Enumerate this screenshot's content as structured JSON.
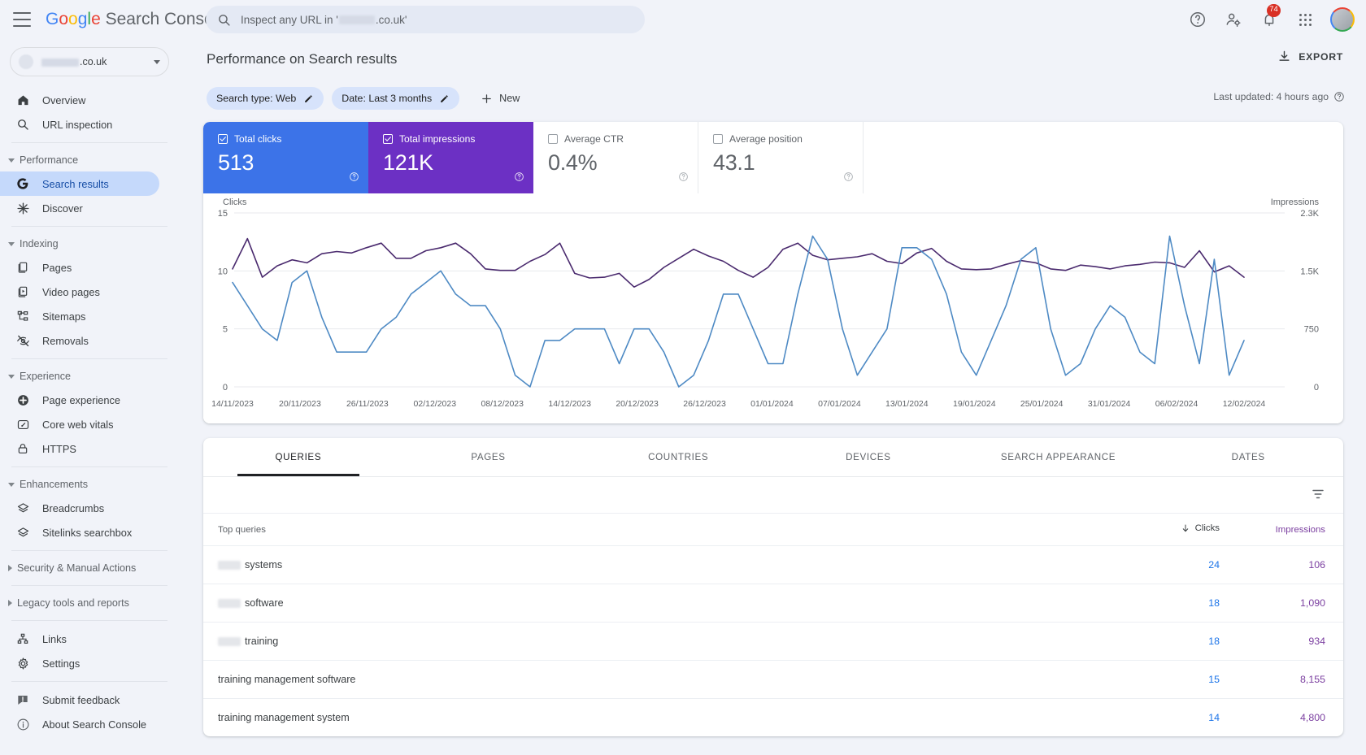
{
  "header": {
    "product_name_parts": [
      "G",
      "o",
      "o",
      "g",
      "l",
      "e"
    ],
    "product_suffix": " Search Console",
    "search_placeholder_pre": "Inspect any URL in '",
    "search_placeholder_post": ".co.uk'",
    "notification_count": "74",
    "icons": [
      "menu-icon",
      "search-icon",
      "help-icon",
      "user-settings-icon",
      "notifications-icon",
      "apps-grid-icon",
      "account-avatar"
    ]
  },
  "sidebar": {
    "property": {
      "name_suffix": ".co.uk"
    },
    "items": [
      {
        "label": "Overview",
        "icon": "home-icon",
        "type": "item"
      },
      {
        "label": "URL inspection",
        "icon": "search-icon",
        "type": "item"
      },
      {
        "label": "Performance",
        "icon": "chevron-down-icon",
        "type": "group",
        "expanded": true
      },
      {
        "label": "Search results",
        "icon": "google-g-icon",
        "type": "item",
        "active": true
      },
      {
        "label": "Discover",
        "icon": "discover-icon",
        "type": "item"
      },
      {
        "label": "Indexing",
        "icon": "chevron-down-icon",
        "type": "group",
        "expanded": true
      },
      {
        "label": "Pages",
        "icon": "pages-icon",
        "type": "item"
      },
      {
        "label": "Video pages",
        "icon": "video-pages-icon",
        "type": "item"
      },
      {
        "label": "Sitemaps",
        "icon": "sitemaps-icon",
        "type": "item"
      },
      {
        "label": "Removals",
        "icon": "removals-icon",
        "type": "item"
      },
      {
        "label": "Experience",
        "icon": "chevron-down-icon",
        "type": "group",
        "expanded": true
      },
      {
        "label": "Page experience",
        "icon": "page-experience-icon",
        "type": "item"
      },
      {
        "label": "Core web vitals",
        "icon": "core-web-vitals-icon",
        "type": "item"
      },
      {
        "label": "HTTPS",
        "icon": "lock-icon",
        "type": "item"
      },
      {
        "label": "Enhancements",
        "icon": "chevron-down-icon",
        "type": "group",
        "expanded": true
      },
      {
        "label": "Breadcrumbs",
        "icon": "breadcrumbs-icon",
        "type": "item"
      },
      {
        "label": "Sitelinks searchbox",
        "icon": "sitelinks-icon",
        "type": "item"
      },
      {
        "label": "Security & Manual Actions",
        "icon": "chevron-right-icon",
        "type": "group",
        "expanded": false
      },
      {
        "label": "Legacy tools and reports",
        "icon": "chevron-right-icon",
        "type": "group",
        "expanded": false
      },
      {
        "label": "Links",
        "icon": "links-icon",
        "type": "item"
      },
      {
        "label": "Settings",
        "icon": "gear-icon",
        "type": "item"
      },
      {
        "label": "Submit feedback",
        "icon": "feedback-icon",
        "type": "item"
      },
      {
        "label": "About Search Console",
        "icon": "info-icon",
        "type": "item"
      }
    ]
  },
  "main": {
    "page_title": "Performance on Search results",
    "export_label": "EXPORT",
    "last_updated": "Last updated: 4 hours ago",
    "filters": [
      {
        "label": "Search type: Web"
      },
      {
        "label": "Date: Last 3 months"
      }
    ],
    "new_filter_label": "New",
    "metrics": [
      {
        "label": "Total clicks",
        "value": "513",
        "checked": true,
        "color": "#3c73e8"
      },
      {
        "label": "Total impressions",
        "value": "121K",
        "checked": true,
        "color": "#6C30C4"
      },
      {
        "label": "Average CTR",
        "value": "0.4%",
        "checked": false,
        "color": "#5f6368"
      },
      {
        "label": "Average position",
        "value": "43.1",
        "checked": false,
        "color": "#5f6368"
      }
    ],
    "tabs": [
      {
        "label": "QUERIES",
        "active": true
      },
      {
        "label": "PAGES",
        "active": false
      },
      {
        "label": "COUNTRIES",
        "active": false
      },
      {
        "label": "DEVICES",
        "active": false
      },
      {
        "label": "SEARCH APPEARANCE",
        "active": false
      },
      {
        "label": "DATES",
        "active": false
      }
    ],
    "table": {
      "columns": [
        "Top queries",
        "Clicks",
        "Impressions"
      ],
      "sort_column": "Clicks",
      "sort_direction": "desc",
      "rows": [
        {
          "query": "systems",
          "redacted": true,
          "clicks": "24",
          "impressions": "106"
        },
        {
          "query": "software",
          "redacted": true,
          "clicks": "18",
          "impressions": "1,090"
        },
        {
          "query": "training",
          "redacted": true,
          "clicks": "18",
          "impressions": "934"
        },
        {
          "query": "training management software",
          "redacted": false,
          "clicks": "15",
          "impressions": "8,155"
        },
        {
          "query": "training management system",
          "redacted": false,
          "clicks": "14",
          "impressions": "4,800"
        }
      ]
    }
  },
  "chart_data": {
    "type": "line",
    "title": "",
    "ylabel_left": "Clicks",
    "ylabel_right": "Impressions",
    "ylim_left": [
      0,
      15
    ],
    "ylim_right": [
      0,
      2300
    ],
    "yticks_left": [
      "15",
      "10",
      "5",
      "0"
    ],
    "yticks_right": [
      "2.3K",
      "1.5K",
      "750",
      "0"
    ],
    "grid": true,
    "legend_position": "metric-cards",
    "x_tick_labels": [
      "14/11/2023",
      "20/11/2023",
      "26/11/2023",
      "02/12/2023",
      "08/12/2023",
      "14/12/2023",
      "20/12/2023",
      "26/12/2023",
      "01/01/2024",
      "07/01/2024",
      "13/01/2024",
      "19/01/2024",
      "25/01/2024",
      "31/01/2024",
      "06/02/2024",
      "12/02/2024"
    ],
    "series": [
      {
        "name": "Total clicks",
        "color": "#4e8ac4",
        "axis": "left",
        "values": [
          9,
          7,
          5,
          4,
          9,
          10,
          6,
          3,
          3,
          3,
          5,
          6,
          8,
          9,
          10,
          8,
          7,
          7,
          5,
          1,
          0,
          4,
          4,
          5,
          5,
          5,
          2,
          5,
          5,
          3,
          0,
          1,
          4,
          8,
          8,
          5,
          2,
          2,
          8,
          13,
          11,
          5,
          1,
          3,
          5,
          12,
          12,
          11,
          8,
          3,
          1,
          4,
          7,
          11,
          12,
          5,
          1,
          2,
          5,
          7,
          6,
          3,
          2,
          13,
          7,
          2,
          11,
          1,
          4
        ]
      },
      {
        "name": "Total impressions",
        "color": "#4a2a6e",
        "axis": "right",
        "values": [
          1560,
          1960,
          1450,
          1600,
          1680,
          1640,
          1760,
          1790,
          1770,
          1840,
          1900,
          1700,
          1700,
          1800,
          1840,
          1900,
          1760,
          1560,
          1540,
          1540,
          1660,
          1750,
          1900,
          1500,
          1440,
          1450,
          1500,
          1320,
          1420,
          1580,
          1700,
          1820,
          1730,
          1660,
          1540,
          1450,
          1580,
          1820,
          1900,
          1740,
          1680,
          1700,
          1720,
          1760,
          1660,
          1630,
          1770,
          1830,
          1660,
          1560,
          1550,
          1560,
          1620,
          1670,
          1640,
          1560,
          1540,
          1610,
          1590,
          1560,
          1600,
          1620,
          1650,
          1640,
          1580,
          1800,
          1520,
          1600,
          1450
        ]
      }
    ]
  }
}
